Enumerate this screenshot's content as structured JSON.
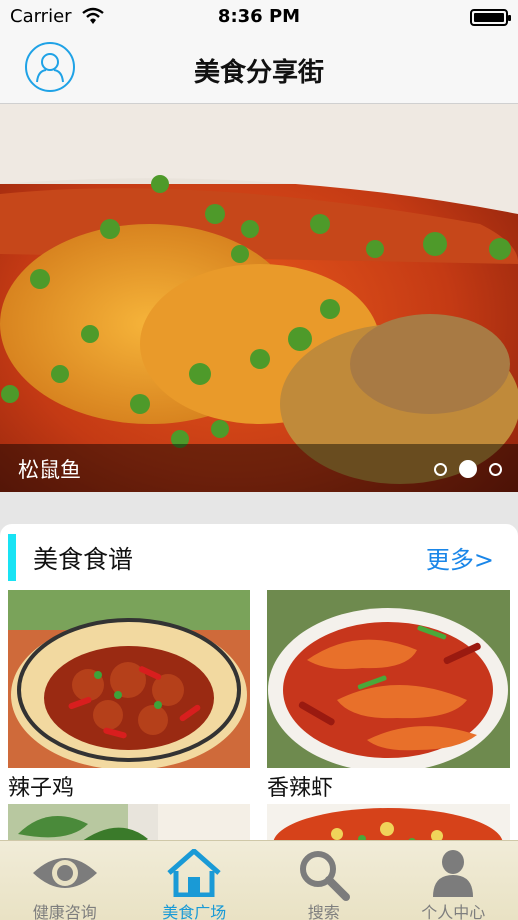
{
  "status_bar": {
    "carrier": "Carrier",
    "time": "8:36 PM"
  },
  "nav": {
    "title": "美食分享街"
  },
  "banner": {
    "caption": "松鼠鱼",
    "page_count": 3,
    "active_page": 2
  },
  "recipes": {
    "title": "美食食谱",
    "more": "更多>",
    "items": [
      {
        "name": "辣子鸡"
      },
      {
        "name": "香辣虾"
      }
    ]
  },
  "tabs": [
    {
      "label": "健康咨询",
      "icon": "eye-icon",
      "active": false
    },
    {
      "label": "美食广场",
      "icon": "home-icon",
      "active": true
    },
    {
      "label": "搜索",
      "icon": "search-icon",
      "active": false
    },
    {
      "label": "个人中心",
      "icon": "person-icon",
      "active": false
    }
  ],
  "colors": {
    "accent": "#1a9ad6",
    "section_bar": "#19e3f4",
    "link": "#1a86e8"
  }
}
